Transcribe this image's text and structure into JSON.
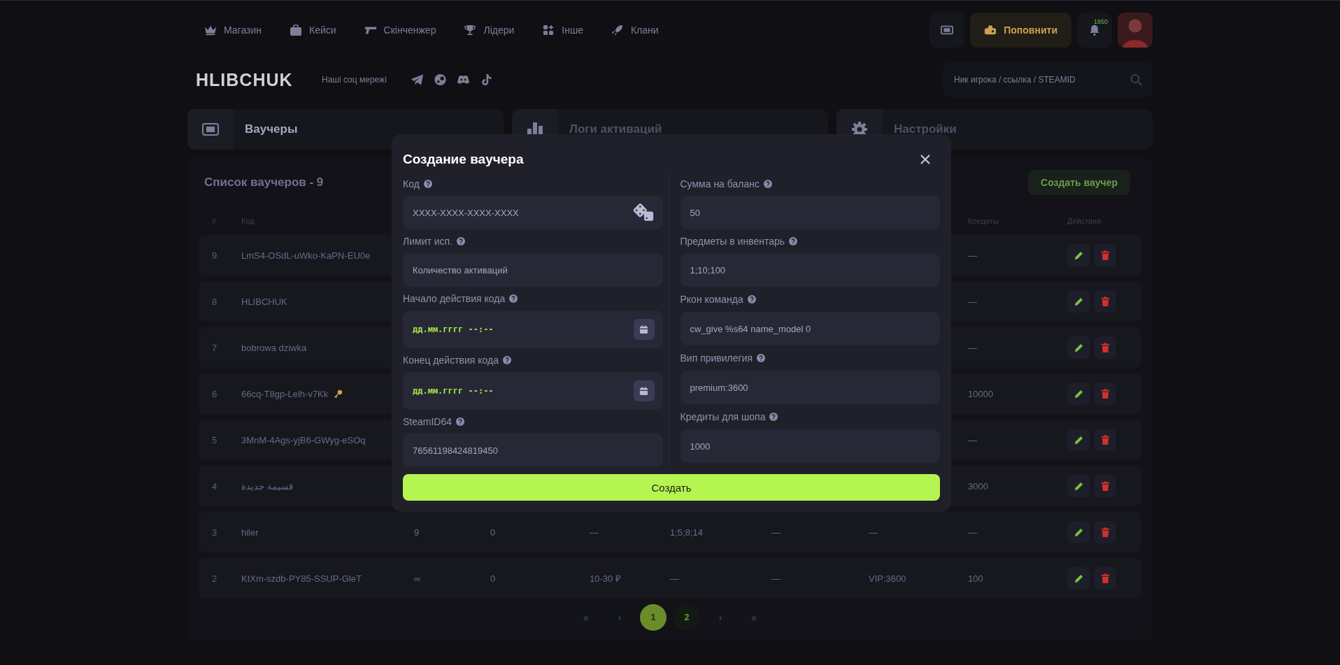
{
  "nav": {
    "items": [
      {
        "label": "Магазин"
      },
      {
        "label": "Кейси"
      },
      {
        "label": "Скінченжер"
      },
      {
        "label": "Лідери"
      },
      {
        "label": "Інше"
      },
      {
        "label": "Клани"
      }
    ],
    "topup": "Поповнити",
    "notifications": "1850"
  },
  "header": {
    "logo": "HLIBCHUK",
    "socials_label": "Наші соц мережі",
    "search": {
      "placeholder": "Ник игрока / ссылка / STEAMID"
    }
  },
  "tabs": [
    {
      "label": "Ваучеры",
      "selected": true
    },
    {
      "label": "Логи активаций",
      "selected": false
    },
    {
      "label": "Настройки",
      "selected": false
    }
  ],
  "vouchers": {
    "title": "Список ваучеров - 9",
    "create_button": "Создать ваучер",
    "columns": {
      "number": "#",
      "code": "Код",
      "credits": "Кредиты",
      "actions": "Действия"
    },
    "rows": [
      {
        "number": "9",
        "code": "LmS4-OSdL-uWko-KaPN-EU0e",
        "key": false,
        "credits": "—"
      },
      {
        "number": "8",
        "code": "HLIBCHUK",
        "key": false,
        "credits": "—"
      },
      {
        "number": "7",
        "code": "bobrowa dziwka",
        "key": false,
        "credits": "—"
      },
      {
        "number": "6",
        "code": "66cq-T8gp-Lelh-v7Kk",
        "key": true,
        "credits": "10000"
      },
      {
        "number": "5",
        "code": "3MnM-4Ags-yjB6-GWyg-eSOq",
        "key": false,
        "credits": "—"
      },
      {
        "number": "4",
        "code": "قسيمة جديدة",
        "key": false,
        "credits": "3000"
      },
      {
        "number": "3",
        "code": "hiler",
        "key": false,
        "column_3": "9",
        "column_4": "0",
        "column_5": "—",
        "column_6": "1;5;8;14",
        "column_7": "—",
        "column_8": "—",
        "credits": "—"
      },
      {
        "number": "2",
        "code": "KtXm-szdb-PY85-SSUP-GleT",
        "key": false,
        "column_3": "∞",
        "column_4": "0",
        "column_5": "10-30 ₽",
        "column_6": "—",
        "column_7": "—",
        "column_8": "VIP:3600",
        "credits": "100"
      }
    ],
    "pagination": [
      {
        "label": "«",
        "kind": "nav",
        "selected": false
      },
      {
        "label": "‹",
        "kind": "nav",
        "selected": false
      },
      {
        "label": "1",
        "kind": "page",
        "selected": true
      },
      {
        "label": "2",
        "kind": "page",
        "selected": false
      },
      {
        "label": "›",
        "kind": "nav",
        "selected": false
      },
      {
        "label": "»",
        "kind": "nav",
        "selected": false
      }
    ]
  },
  "modal": {
    "title": "Создание ваучера",
    "left": [
      {
        "label": "Код",
        "kind": "generate",
        "placeholder": "XXXX-XXXX-XXXX-XXXX"
      },
      {
        "label": "Лимит исп.",
        "kind": "text",
        "placeholder": "Количество активаций"
      },
      {
        "label": "Начало действия кода",
        "kind": "date",
        "placeholder": "дд.мм.гггг --:--"
      },
      {
        "label": "Конец действия кода",
        "kind": "date",
        "placeholder": "дд.мм.гггг --:--"
      },
      {
        "label": "SteamID64",
        "kind": "text",
        "placeholder": "76561198424819450"
      }
    ],
    "right": [
      {
        "label": "Сумма на баланс",
        "kind": "text",
        "placeholder": "50"
      },
      {
        "label": "Предметы в инвентарь",
        "kind": "text",
        "placeholder": "1;10;100"
      },
      {
        "label": "Ркон команда",
        "kind": "text",
        "placeholder": "cw_give %s64 name_model 0"
      },
      {
        "label": "Вип привилегия",
        "kind": "text",
        "placeholder": "premium:3600"
      },
      {
        "label": "Кредиты для шопа",
        "kind": "text",
        "placeholder": "1000"
      }
    ],
    "submit": "Создать"
  }
}
